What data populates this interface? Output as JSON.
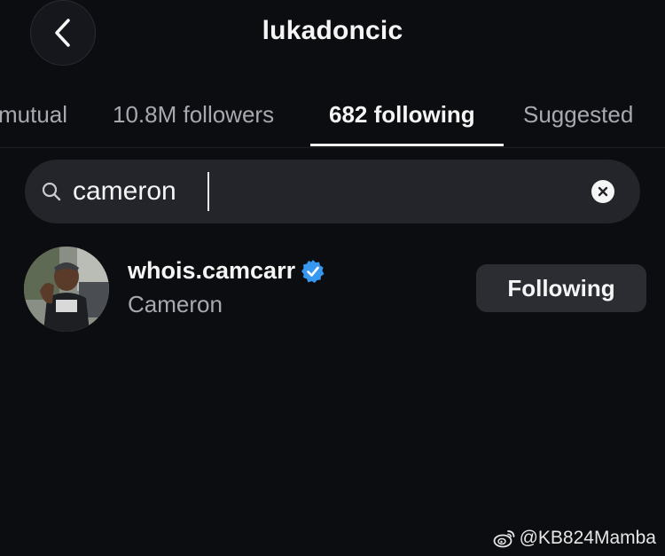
{
  "header": {
    "title": "lukadoncic",
    "back_icon": "chevron-left-icon"
  },
  "tabs": [
    {
      "label": "mutual",
      "active": false
    },
    {
      "label": "10.8M followers",
      "active": false
    },
    {
      "label": "682 following",
      "active": true
    },
    {
      "label": "Suggested",
      "active": false
    }
  ],
  "search": {
    "value": "cameron",
    "placeholder": "Search",
    "icon": "search-icon",
    "clear_icon": "clear-icon"
  },
  "results": [
    {
      "username": "whois.camcarr",
      "display_name": "Cameron",
      "verified": true,
      "button_label": "Following"
    }
  ],
  "watermark": {
    "text": "@KB824Mamba",
    "icon": "weibo-icon"
  },
  "colors": {
    "background": "#0c0d11",
    "search_bg": "#23252b",
    "button_bg": "#2b2d33",
    "verified_blue": "#3897f0",
    "secondary_text": "#a7a9b0"
  }
}
